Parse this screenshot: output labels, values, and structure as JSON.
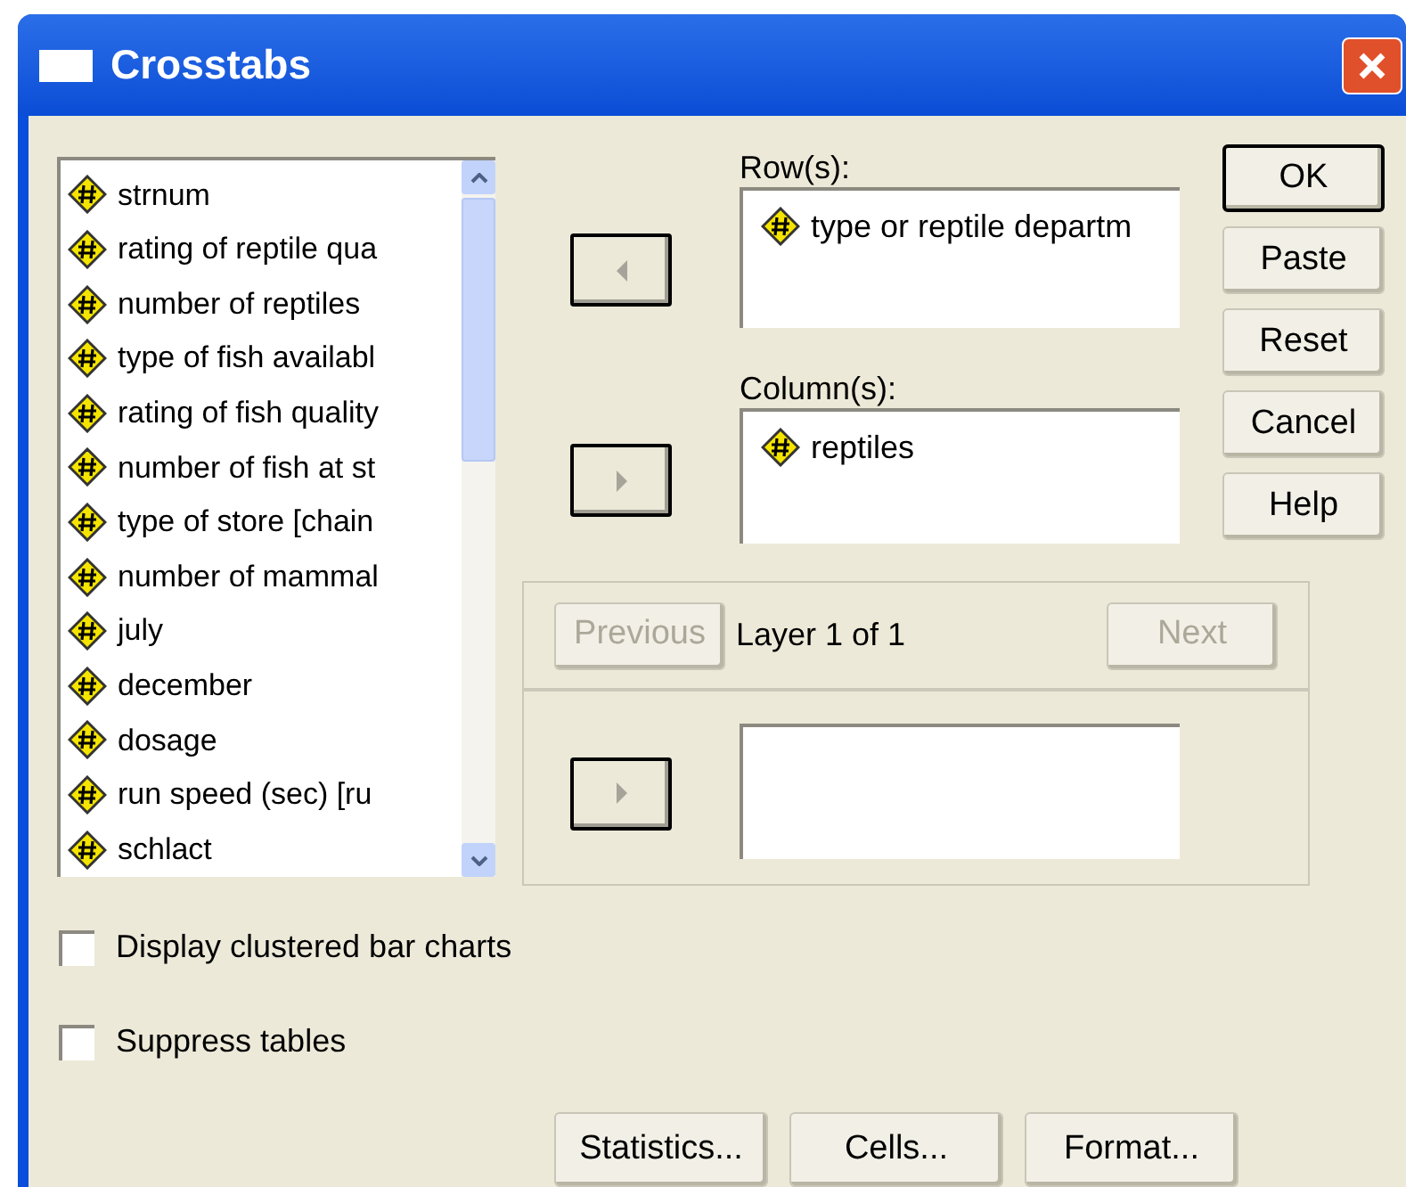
{
  "window": {
    "title": "Crosstabs"
  },
  "variables": [
    {
      "label": "strnum"
    },
    {
      "label": "rating of reptile qua"
    },
    {
      "label": "number of reptiles"
    },
    {
      "label": "type of fish availabl"
    },
    {
      "label": "rating of fish quality"
    },
    {
      "label": "number of fish at st"
    },
    {
      "label": "type of store [chain"
    },
    {
      "label": "number of mammal"
    },
    {
      "label": "july"
    },
    {
      "label": "december"
    },
    {
      "label": "dosage"
    },
    {
      "label": "run speed (sec) [ru"
    },
    {
      "label": "schlact"
    }
  ],
  "arrow_buttons": [
    {
      "kind": "left"
    },
    {
      "kind": "right"
    },
    {
      "kind": "right"
    }
  ],
  "rows_field": {
    "label": "Row(s):",
    "items": [
      "type or reptile departm"
    ]
  },
  "columns_field": {
    "label": "Column(s):",
    "items": [
      "reptiles"
    ]
  },
  "actions": [
    {
      "label": "OK",
      "default": true
    },
    {
      "label": "Paste",
      "default": false
    },
    {
      "label": "Reset",
      "default": false
    },
    {
      "label": "Cancel",
      "default": false
    },
    {
      "label": "Help",
      "default": false
    }
  ],
  "layer": {
    "previous": {
      "label": "Previous",
      "disabled": true
    },
    "caption": "Layer 1 of 1",
    "next": {
      "label": "Next",
      "disabled": true
    }
  },
  "checkboxes": [
    {
      "label": "Display clustered bar charts",
      "checked": false
    },
    {
      "label": "Suppress tables",
      "checked": false
    }
  ],
  "bottom_buttons": [
    "Statistics...",
    "Cells...",
    "Format..."
  ]
}
